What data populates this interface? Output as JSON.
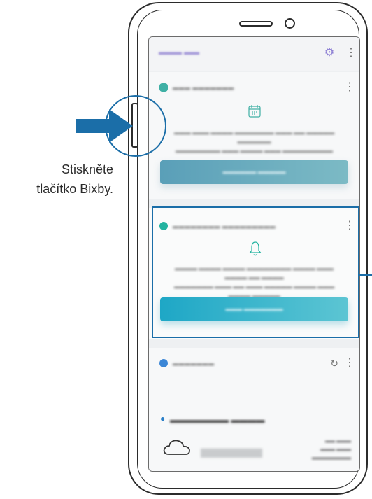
{
  "caption": {
    "line1": "Stiskněte",
    "line2": "tlačítko Bixby."
  },
  "icons": {
    "settings": "gear-icon",
    "more": "more-vertical-icon",
    "calendar": "calendar-icon",
    "bell": "bell-icon",
    "refresh": "refresh-icon",
    "weather": "cloud-icon",
    "location": "location-pin-icon"
  },
  "colors": {
    "accent_blue": "#1b6ea8",
    "button_teal": "#1ea7c6",
    "greeting_purple": "#9b8fd6"
  }
}
